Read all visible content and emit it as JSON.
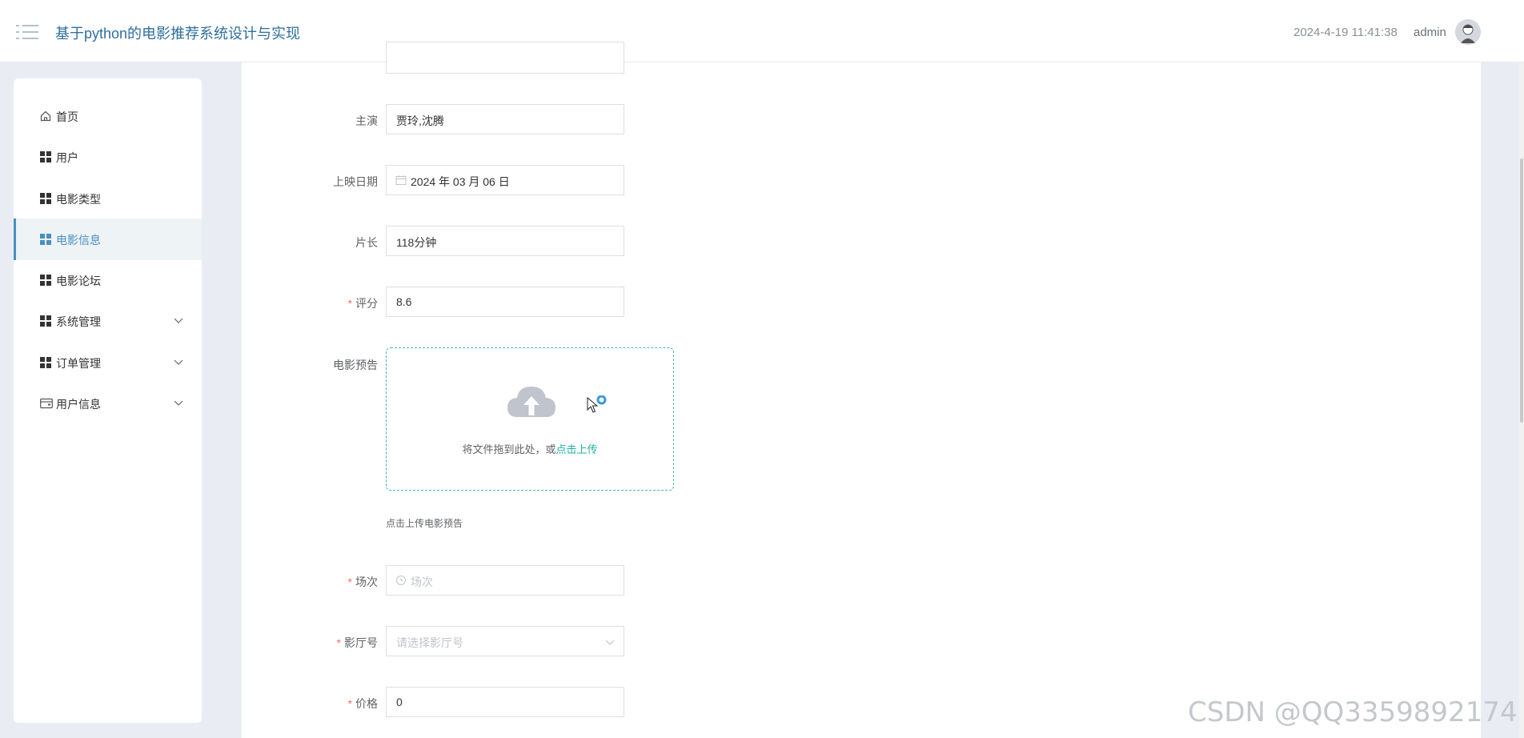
{
  "header": {
    "title": "基于python的电影推荐系统设计与实现",
    "datetime": "2024-4-19 11:41:38",
    "username": "admin"
  },
  "sidebar": {
    "items": [
      {
        "label": "首页",
        "icon": "home-icon"
      },
      {
        "label": "用户",
        "icon": "grid-icon"
      },
      {
        "label": "电影类型",
        "icon": "grid-icon"
      },
      {
        "label": "电影信息",
        "icon": "grid-icon",
        "active": true
      },
      {
        "label": "电影论坛",
        "icon": "grid-icon"
      },
      {
        "label": "系统管理",
        "icon": "grid-icon",
        "expandable": true
      },
      {
        "label": "订单管理",
        "icon": "grid-icon",
        "expandable": true
      },
      {
        "label": "用户信息",
        "icon": "wallet-icon",
        "expandable": true
      }
    ]
  },
  "form": {
    "cast": {
      "label": "主演",
      "value": "贾玲,沈腾"
    },
    "release_date": {
      "label": "上映日期",
      "value": "2024 年 03 月 06 日"
    },
    "duration": {
      "label": "片长",
      "value": "118分钟"
    },
    "rating": {
      "label": "评分",
      "value": "8.6",
      "required": true
    },
    "trailer": {
      "label": "电影预告",
      "drop_text": "将文件拖到此处，或",
      "link_text": "点击上传",
      "tip": "点击上传电影预告"
    },
    "session": {
      "label": "场次",
      "placeholder": "场次",
      "required": true
    },
    "hall": {
      "label": "影厅号",
      "placeholder": "请选择影厅号",
      "required": true
    },
    "price": {
      "label": "价格",
      "value": "0",
      "required": true
    }
  },
  "watermark": "CSDN @QQ3359892174",
  "colors": {
    "accent": "#4a8fc0",
    "required": "#f56c6c",
    "upload_border": "#4ab0c1",
    "link": "#1fb0a2"
  }
}
